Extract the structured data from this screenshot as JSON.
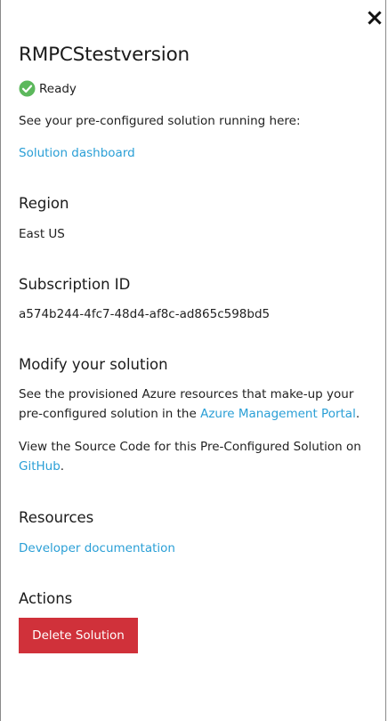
{
  "panel": {
    "title": "RMPCStestversion",
    "status_label": "Ready",
    "close_icon": "close-icon",
    "status_icon": "check-circle-icon",
    "status_color": "#5cb85c"
  },
  "intro": {
    "text": "See your pre-configured solution running here:",
    "dashboard_link": "Solution dashboard"
  },
  "region": {
    "heading": "Region",
    "value": "East US"
  },
  "subscription": {
    "heading": "Subscription ID",
    "value": "a574b244-4fc7-48d4-af8c-ad865c598bd5"
  },
  "modify": {
    "heading": "Modify your solution",
    "text_before_link": "See the provisioned Azure resources that make-up your pre-configured solution in the ",
    "portal_link": "Azure Management Portal",
    "text_after_link": ".",
    "source_text": "View the Source Code for this Pre-Configured Solution on ",
    "github_link": "GitHub",
    "source_after": "."
  },
  "resources": {
    "heading": "Resources",
    "doc_link": "Developer documentation"
  },
  "actions": {
    "heading": "Actions",
    "delete_label": "Delete Solution",
    "delete_color": "#d0313a"
  },
  "colors": {
    "link": "#2a9fd6",
    "text": "#212121"
  }
}
